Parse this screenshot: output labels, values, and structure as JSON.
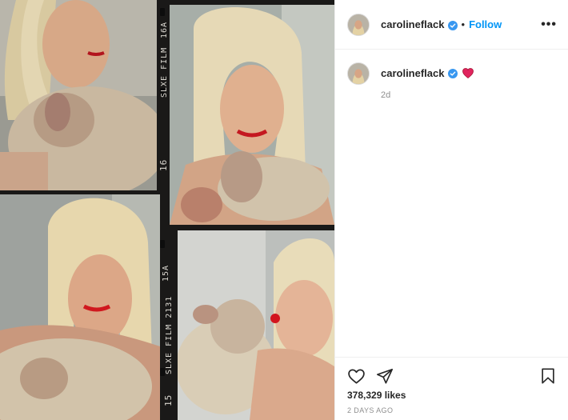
{
  "photo": {
    "description_icon": "photo-strip-image",
    "film_labels": [
      "16A",
      "SLXE FILM",
      "16",
      "15A",
      "SLXE FILM 2131",
      "15"
    ]
  },
  "header": {
    "username": "carolineflack",
    "verified_icon": "verified-badge-icon",
    "separator": "•",
    "follow_label": "Follow",
    "more_label": "•••"
  },
  "caption": {
    "username": "carolineflack",
    "emoji_icon": "red-heart-icon",
    "time_ago": "2d"
  },
  "actions": {
    "like_icon": "heart-outline-icon",
    "share_icon": "paper-plane-icon",
    "save_icon": "bookmark-icon",
    "likes": "378,329 likes",
    "date": "2 DAYS AGO"
  },
  "colors": {
    "accent": "#0095f6",
    "verified": "#3897f0",
    "heart": "#e0245e",
    "muted": "#8e8e8e"
  }
}
